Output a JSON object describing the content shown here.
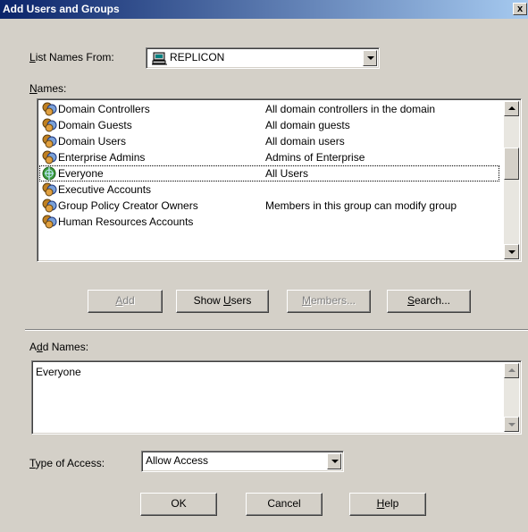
{
  "window": {
    "title": "Add Users and Groups",
    "close_glyph": "x"
  },
  "list_from": {
    "label_u": "L",
    "label_rest": "ist Names From:",
    "value": "REPLICON",
    "icon": "network-computer-icon"
  },
  "names": {
    "label_u": "N",
    "label_rest": "ames:",
    "rows": [
      {
        "name": "Domain Controllers",
        "desc": "All domain controllers in the domain",
        "icon": "group-icon"
      },
      {
        "name": "Domain Guests",
        "desc": "All domain guests",
        "icon": "group-icon"
      },
      {
        "name": "Domain Users",
        "desc": "All domain users",
        "icon": "group-icon"
      },
      {
        "name": "Enterprise Admins",
        "desc": "Admins of Enterprise",
        "icon": "group-icon"
      },
      {
        "name": "Everyone",
        "desc": "All Users",
        "icon": "globe-icon",
        "selected": true
      },
      {
        "name": "Executive Accounts",
        "desc": "",
        "icon": "group-icon"
      },
      {
        "name": "Group Policy Creator Owners",
        "desc": "Members in this group can modify group",
        "icon": "group-icon"
      },
      {
        "name": "Human Resources Accounts",
        "desc": "",
        "icon": "group-icon"
      }
    ]
  },
  "buttons": {
    "add": {
      "u": "A",
      "rest": "dd"
    },
    "show_users": {
      "pre": "Show ",
      "u": "U",
      "rest": "sers"
    },
    "members": {
      "u": "M",
      "rest": "embers..."
    },
    "search": {
      "u": "S",
      "rest": "earch..."
    }
  },
  "add_names": {
    "label_pre": "A",
    "label_u": "d",
    "label_rest": "d Names:",
    "value": "Everyone"
  },
  "access": {
    "label_u": "T",
    "label_rest": "ype of Access:",
    "value": "Allow Access"
  },
  "footer": {
    "ok": "OK",
    "cancel": "Cancel",
    "help_u": "H",
    "help_rest": "elp"
  },
  "colors": {
    "title_start": "#0a246a",
    "title_end": "#a6caf0",
    "face": "#d4d0c8"
  }
}
